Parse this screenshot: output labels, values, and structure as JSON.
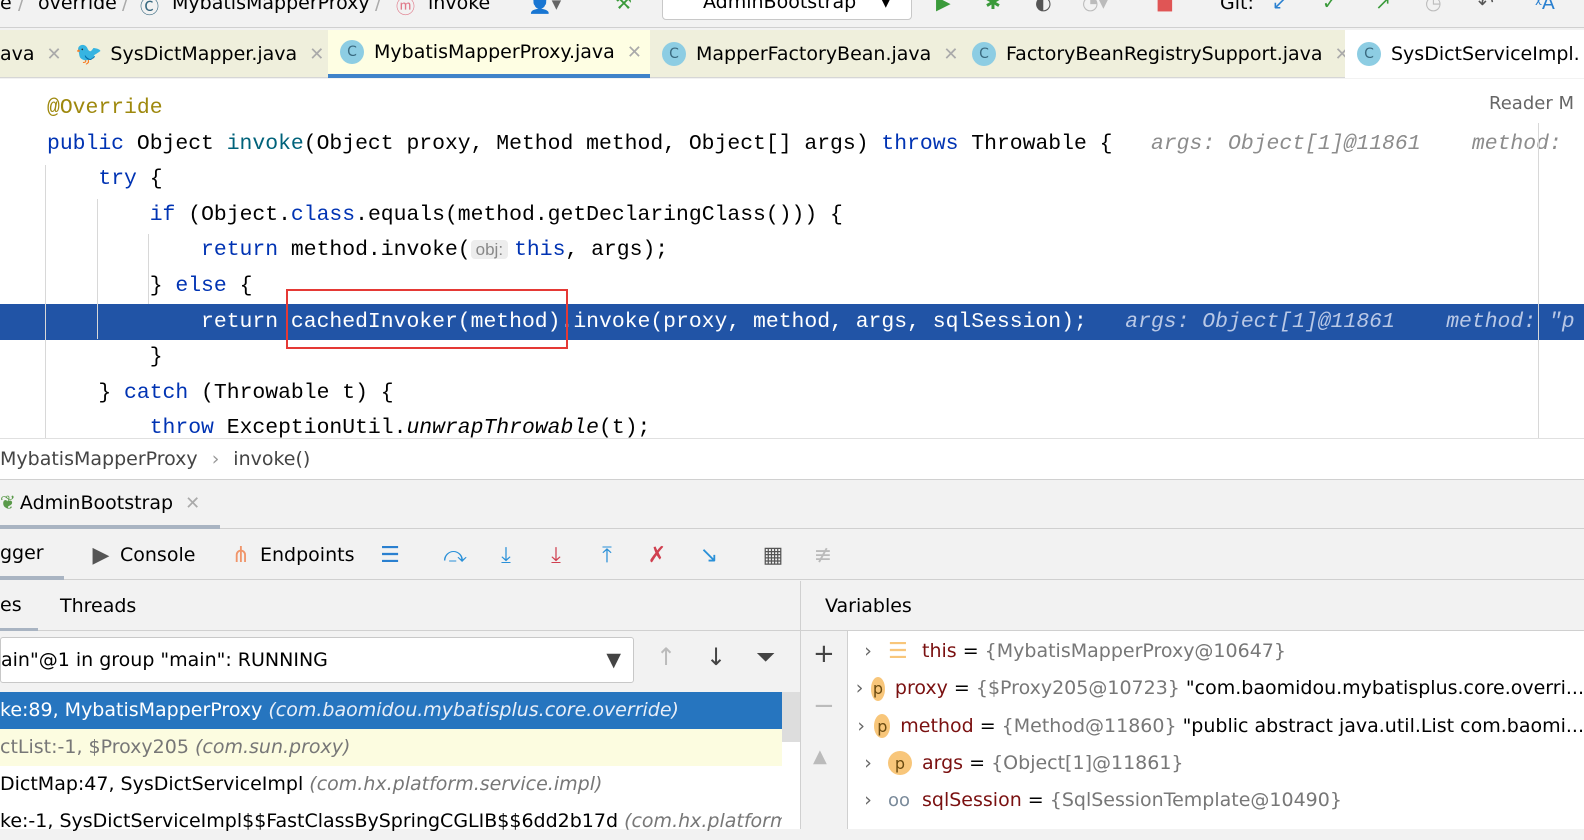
{
  "nav": {
    "crumbs": [
      "e",
      "override",
      "MybatisMapperProxy",
      "invoke"
    ],
    "run_config": "AdminBootstrap",
    "git_label": "Git:"
  },
  "tabs": [
    {
      "label": "ava",
      "icon": "class"
    },
    {
      "label": "SysDictMapper.java",
      "icon": "mybatis-bird"
    },
    {
      "label": "MybatisMapperProxy.java",
      "icon": "class",
      "active": true
    },
    {
      "label": "MapperFactoryBean.java",
      "icon": "class"
    },
    {
      "label": "FactoryBeanRegistrySupport.java",
      "icon": "class"
    },
    {
      "label": "SysDictServiceImpl.",
      "icon": "class"
    }
  ],
  "editor": {
    "reader_mode": "Reader M",
    "lines": [
      [
        [
          "ann",
          "@Override"
        ]
      ],
      [
        [
          "kw",
          "public "
        ],
        [
          "",
          "Object "
        ],
        [
          "fn",
          "invoke"
        ],
        [
          "",
          "(Object proxy, Method method, Object[] args) "
        ],
        [
          "kw",
          "throws"
        ],
        [
          "",
          " Throwable {  "
        ],
        [
          "hint",
          " args: Object[1]@11861    method: "
        ]
      ],
      [
        [
          "",
          "    "
        ],
        [
          "kw",
          "try"
        ],
        [
          "",
          " {"
        ]
      ],
      [
        [
          "",
          "        "
        ],
        [
          "kw",
          "if"
        ],
        [
          "",
          " (Object."
        ],
        [
          "kw",
          "class"
        ],
        [
          "",
          ".equals(method.getDeclaringClass())) {"
        ]
      ],
      [
        [
          "",
          "            "
        ],
        [
          "kw",
          "return"
        ],
        [
          "",
          " method.invoke("
        ],
        [
          "inl",
          "obj:"
        ],
        [
          "kw",
          "this"
        ],
        [
          "",
          ", args);"
        ]
      ],
      [
        [
          "",
          "        } "
        ],
        [
          "kw",
          "else"
        ],
        [
          "",
          " {"
        ]
      ],
      [
        [
          "",
          "            "
        ],
        [
          "kw",
          "return"
        ],
        [
          "",
          " cachedInvoker(method).invoke(proxy, method, args, sqlSession);  "
        ],
        [
          "hint",
          " args: Object[1]@11861    method: \"p"
        ]
      ],
      [
        [
          "",
          "        }"
        ]
      ],
      [
        [
          "",
          "    } "
        ],
        [
          "kw",
          "catch"
        ],
        [
          "",
          " (Throwable t) {"
        ]
      ],
      [
        [
          "",
          "        "
        ],
        [
          "kw",
          "throw"
        ],
        [
          "",
          " ExceptionUtil."
        ],
        [
          "it",
          "unwrapThrowable"
        ],
        [
          "",
          "(t);"
        ]
      ]
    ]
  },
  "breadcrumb": [
    "MybatisMapperProxy",
    "invoke()"
  ],
  "run_tab": "AdminBootstrap",
  "debug_toolbar": {
    "debugger": "gger",
    "console": "Console",
    "endpoints": "Endpoints"
  },
  "panels": {
    "frames": "es",
    "threads": "Threads",
    "variables": "Variables"
  },
  "thread": "ain\"@1 in group \"main\": RUNNING",
  "frames": [
    {
      "text": "ke:89, MybatisMapperProxy ",
      "pkg": "(com.baomidou.mybatisplus.core.override)",
      "state": "selected"
    },
    {
      "text": "ctList:-1, $Proxy205 ",
      "pkg": "(com.sun.proxy)",
      "state": "library"
    },
    {
      "text": "DictMap:47, SysDictServiceImpl ",
      "pkg": "(com.hx.platform.service.impl)",
      "state": "normal"
    },
    {
      "text": "ke:-1, SysDictServiceImpl$$FastClassBySpringCGLIB$$6dd2b17d ",
      "pkg": "(com.hx.platform.service",
      "state": "normal"
    }
  ],
  "variables": [
    {
      "icon": "field-stack",
      "name": "this",
      "type": "{MybatisMapperProxy@10647}",
      "value": ""
    },
    {
      "icon": "p",
      "name": "proxy",
      "type": "{$Proxy205@10723}",
      "value": "\"com.baomidou.mybatisplus.core.overri..."
    },
    {
      "icon": "p",
      "name": "method",
      "type": "{Method@11860}",
      "value": "\"public abstract java.util.List com.baomi..."
    },
    {
      "icon": "p",
      "name": "args",
      "type": "{Object[1]@11861}",
      "value": ""
    },
    {
      "icon": "watch-glasses",
      "name": "sqlSession",
      "type": "{SqlSessionTemplate@10490}",
      "value": ""
    }
  ],
  "colors": {
    "highlight_line": "#2154a6",
    "selected_frame": "#2675bf",
    "keyword": "#0033b3",
    "annotation": "#9e880d",
    "red_box": "#e53935"
  }
}
